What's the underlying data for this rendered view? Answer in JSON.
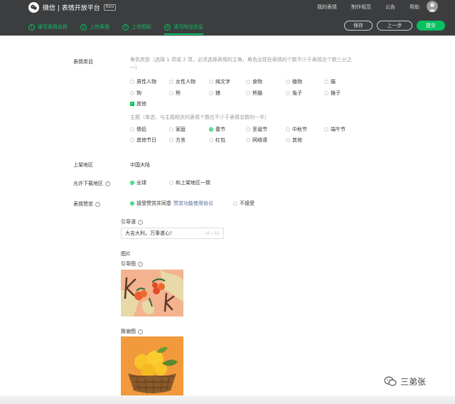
{
  "header": {
    "title": "微信 | 表情开放平台",
    "beta": "Beta",
    "nav": [
      "我的表情",
      "制作规范",
      "公告",
      "帮助"
    ]
  },
  "steps": [
    {
      "num": "1",
      "label": "填写表情名称"
    },
    {
      "num": "2",
      "label": "上传表情"
    },
    {
      "num": "3",
      "label": "上传图标"
    },
    {
      "num": "4",
      "label": "填写附加信息"
    }
  ],
  "actions": {
    "save": "保存",
    "prev": "上一步",
    "submit": "提交"
  },
  "form": {
    "category_label": "表情类目",
    "role_hint_line1": "角色类型（选择 1 项或 2 项，必须选择表情的主角，角色出现在表情的个数不少于表情总个数三分之",
    "role_hint_line2": "一）",
    "roles": [
      "男性人物",
      "女性人物",
      "纯文字",
      "食物",
      "植物",
      "猫",
      "狗",
      "熊",
      "猪",
      "熊猫",
      "兔子",
      "猴子",
      "其他"
    ],
    "theme_hint": "主题（单选，与主题相关的表情个数应不少于表情总数的一半）",
    "themes": [
      "情侣",
      "家庭",
      "春节",
      "圣诞节",
      "中秋节",
      "端午节",
      "其他节日",
      "方言",
      "红包",
      "网络语",
      "其他"
    ],
    "region_label": "上架地区",
    "region_value": "中国大陆",
    "download_label": "允许下载地区",
    "download_options": [
      "全球",
      "和上架地区一致"
    ],
    "reward_label": "表情赞赏",
    "reward_accept": "接受赞赏并同意",
    "reward_link": "赞赏功能使用协议",
    "reward_decline": "不接受",
    "guide_label": "引导语",
    "guide_value": "大吉大利，万事遂心！",
    "guide_count": "10 / 15",
    "images_label": "图片",
    "guide_image_label": "引导图",
    "thanks_image_label": "致谢图"
  },
  "watermark": "三弟张"
}
